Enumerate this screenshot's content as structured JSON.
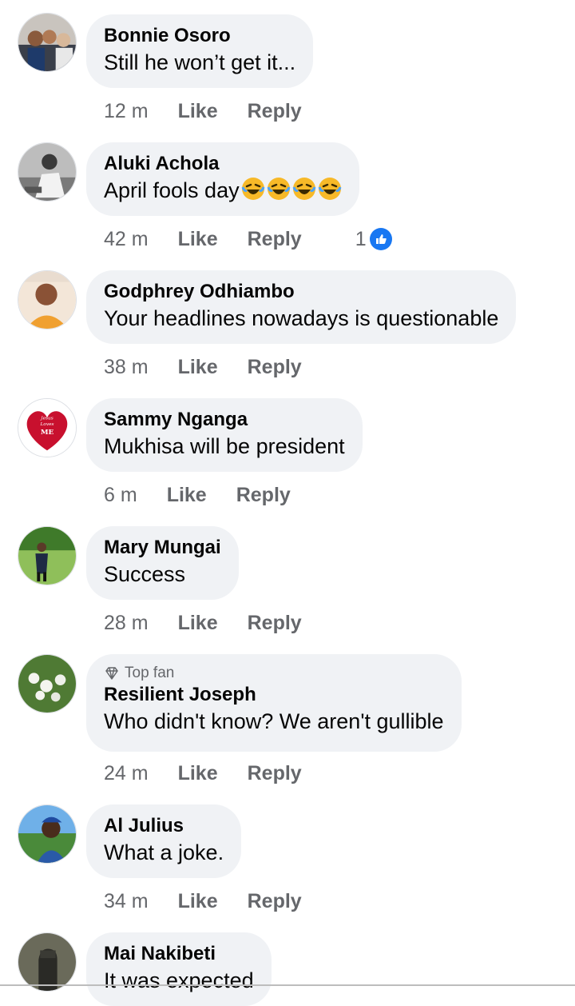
{
  "comments": [
    {
      "name": "Bonnie Osoro",
      "text": "Still he won’t get it...",
      "time": "12 m",
      "like": "Like",
      "reply": "Reply"
    },
    {
      "name": "Aluki Achola",
      "text": "April fools day",
      "emoji": "rolling-on-floor-laughing-emoji",
      "time": "42 m",
      "like": "Like",
      "reply": "Reply",
      "reaction_count": "1"
    },
    {
      "name": "Godphrey Odhiambo",
      "text": "Your headlines nowadays is questionable",
      "time": "38 m",
      "like": "Like",
      "reply": "Reply"
    },
    {
      "name": "Sammy Nganga",
      "text": "Mukhisa will be president",
      "time": "6 m",
      "like": "Like",
      "reply": "Reply",
      "avatar_text": [
        "Jesus",
        "Loves",
        "ME"
      ]
    },
    {
      "name": "Mary Mungai",
      "text": "Success",
      "time": "28 m",
      "like": "Like",
      "reply": "Reply"
    },
    {
      "name": "Resilient Joseph",
      "badge": "Top fan",
      "text": "Who didn't know? We aren't gullible",
      "time": "24 m",
      "like": "Like",
      "reply": "Reply"
    },
    {
      "name": "Al Julius",
      "text": "What a joke.",
      "time": "34 m",
      "like": "Like",
      "reply": "Reply"
    },
    {
      "name": "Mai Nakibeti",
      "text": "It was expected"
    }
  ],
  "colors": {
    "bubble": "#f0f2f5",
    "meta": "#65676b",
    "like_blue": "#1877f2"
  }
}
